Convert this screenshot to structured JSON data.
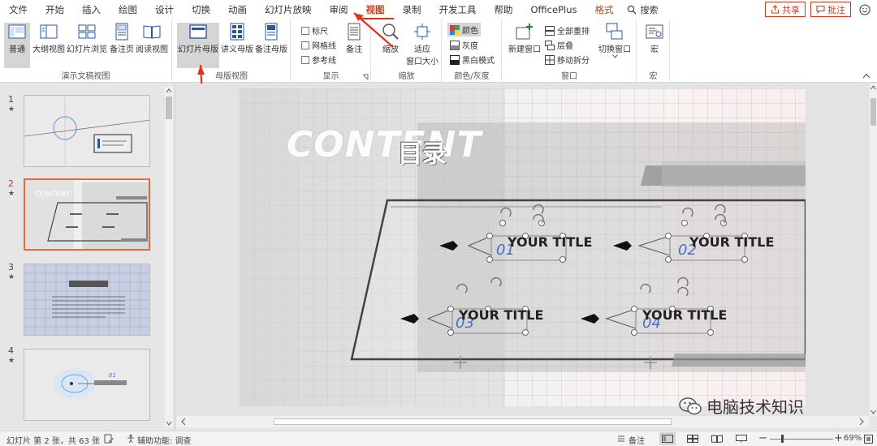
{
  "menu": {
    "tabs": [
      "文件",
      "开始",
      "插入",
      "绘图",
      "设计",
      "切换",
      "动画",
      "幻灯片放映",
      "审阅",
      "视图",
      "录制",
      "开发工具",
      "帮助",
      "OfficePlus",
      "格式"
    ],
    "active_tab": "视图",
    "search_label": "搜索",
    "share_label": "共享",
    "comment_label": "批注"
  },
  "ribbon": {
    "group_presentation_views": {
      "label": "演示文稿视图",
      "buttons": [
        "普通",
        "大纲视图",
        "幻灯片浏览",
        "备注页",
        "阅读视图"
      ]
    },
    "group_master_views": {
      "label": "母版视图",
      "buttons": [
        "幻灯片母版",
        "讲义母版",
        "备注母版"
      ]
    },
    "group_show": {
      "label": "显示",
      "checkboxes": [
        "标尺",
        "网格线",
        "参考线"
      ],
      "notes_button": "备注"
    },
    "group_zoom": {
      "label": "缩放",
      "zoom_button": "缩放",
      "fit_button_line1": "适应",
      "fit_button_line2": "窗口大小"
    },
    "group_color": {
      "label": "颜色/灰度",
      "options": [
        "颜色",
        "灰度",
        "黑白模式"
      ]
    },
    "group_window": {
      "label": "窗口",
      "new_window": "新建窗口",
      "arrange_all": "全部重排",
      "cascade": "层叠",
      "move_split": "移动拆分",
      "switch_window": "切换窗口"
    },
    "group_macros": {
      "label": "宏",
      "macro_button": "宏"
    }
  },
  "thumbnails": [
    {
      "num": "1",
      "star": "★"
    },
    {
      "num": "2",
      "star": "★"
    },
    {
      "num": "3",
      "star": "★"
    },
    {
      "num": "4",
      "star": "★"
    }
  ],
  "slide": {
    "content_text": "CONTENT",
    "title_text": "目录",
    "items": [
      {
        "num": "01",
        "title": "YOUR TITLE"
      },
      {
        "num": "02",
        "title": "YOUR TITLE"
      },
      {
        "num": "03",
        "title": "YOUR TITLE"
      },
      {
        "num": "04",
        "title": "YOUR TITLE"
      }
    ]
  },
  "status": {
    "slide_info": "幻灯片 第 2 张，共 63 张",
    "accessibility": "辅助功能: 调查",
    "notes": "备注",
    "zoom": "69%"
  },
  "watermark": "电脑技术知识",
  "colors": {
    "accent": "#c43e1c",
    "annotation_red": "#e8301c",
    "selected_thumb_border": "#e36c3f",
    "number_blue": "#4a6fc4"
  }
}
